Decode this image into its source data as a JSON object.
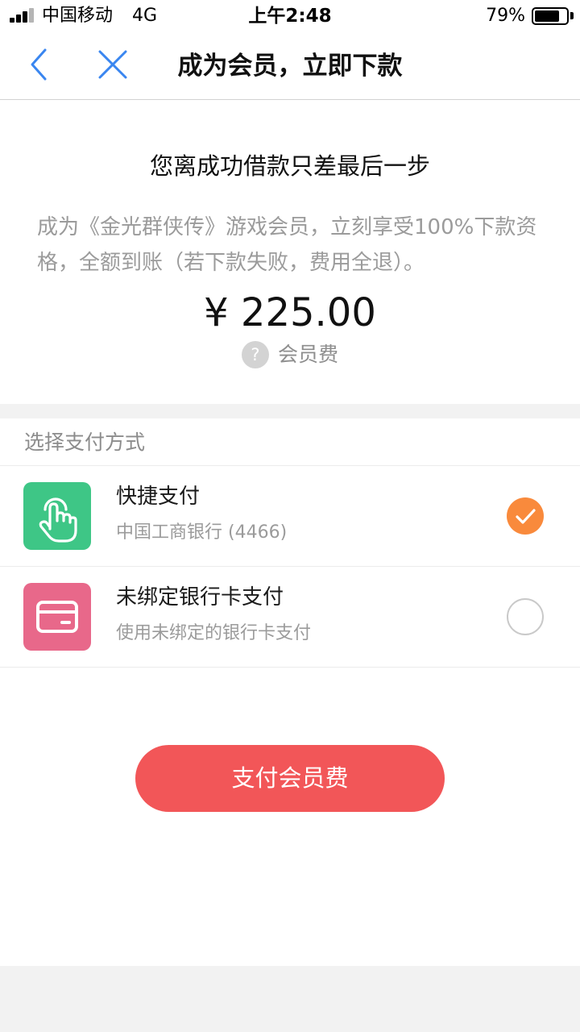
{
  "status_bar": {
    "carrier": "中国移动",
    "network": "4G",
    "time": "上午2:48",
    "battery_percent": "79%",
    "battery_level": 0.79
  },
  "nav": {
    "title": "成为会员，立即下款",
    "back_icon": "chevron-left-icon",
    "close_icon": "close-icon",
    "accent_color": "#3a86f0"
  },
  "hero": {
    "heading": "您离成功借款只差最后一步",
    "description": "成为《金光群侠传》游戏会员，立刻享受100%下款资格，全额到账（若下款失败，费用全退）。",
    "amount": "¥ 225.00",
    "help_icon": "?",
    "fee_label": "会员费"
  },
  "payment": {
    "header": "选择支付方式",
    "options": [
      {
        "name": "快捷支付",
        "detail": "中国工商银行 (4466)",
        "icon": "tap-hand-icon",
        "icon_color": "#3ec686",
        "selected": true
      },
      {
        "name": "未绑定银行卡支付",
        "detail": "使用未绑定的银行卡支付",
        "icon": "bank-card-icon",
        "icon_color": "#e8688a",
        "selected": false
      }
    ],
    "selected_color": "#f98a3c"
  },
  "submit": {
    "label": "支付会员费",
    "color": "#f25658"
  }
}
